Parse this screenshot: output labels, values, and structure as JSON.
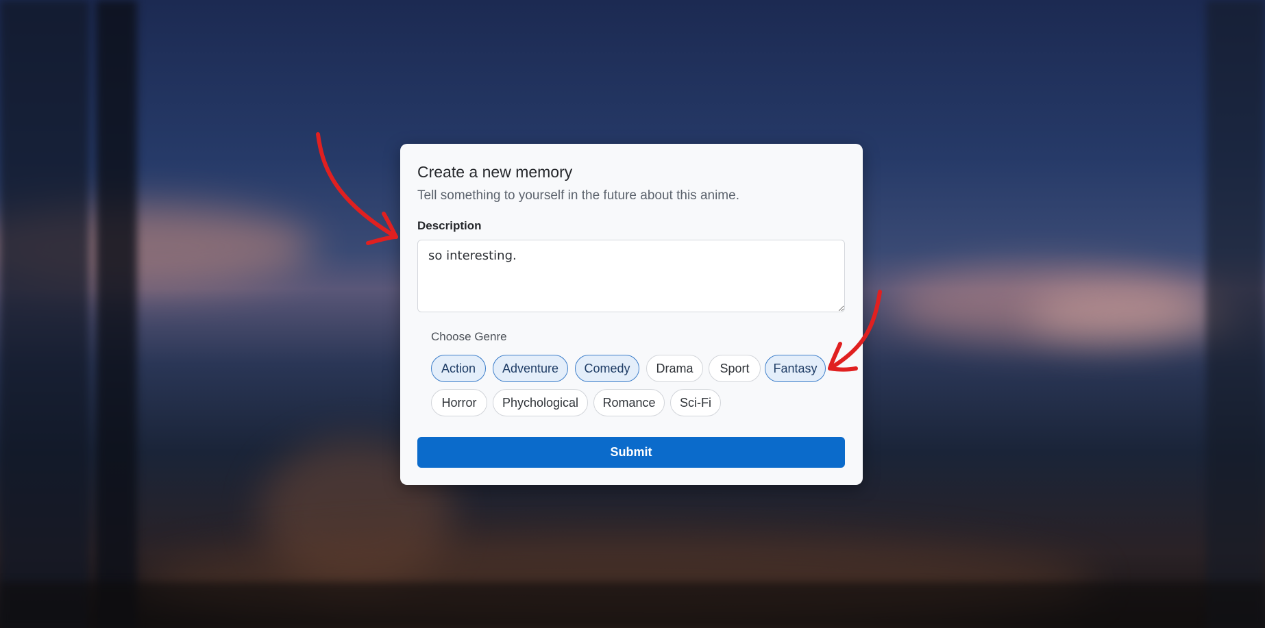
{
  "dialog": {
    "title": "Create a new memory",
    "subtitle": "Tell something to yourself in the future about this anime."
  },
  "description": {
    "label": "Description",
    "value": "so interesting."
  },
  "genres": {
    "label": "Choose Genre",
    "items": [
      {
        "label": "Action",
        "selected": true
      },
      {
        "label": "Adventure",
        "selected": true
      },
      {
        "label": "Comedy",
        "selected": true
      },
      {
        "label": "Drama",
        "selected": false
      },
      {
        "label": "Sport",
        "selected": false
      },
      {
        "label": "Fantasy",
        "selected": true
      },
      {
        "label": "Horror",
        "selected": false
      },
      {
        "label": "Phychological",
        "selected": false
      },
      {
        "label": "Romance",
        "selected": false
      },
      {
        "label": "Sci-Fi",
        "selected": false
      }
    ]
  },
  "submit_label": "Submit",
  "colors": {
    "accent": "#0b6bcb",
    "chip_selected_bg": "#e4eefa",
    "chip_selected_border": "#3a7cc9",
    "annotation_arrow": "#e02020"
  },
  "annotations": [
    "arrow-to-description",
    "arrow-to-fantasy-chip"
  ]
}
